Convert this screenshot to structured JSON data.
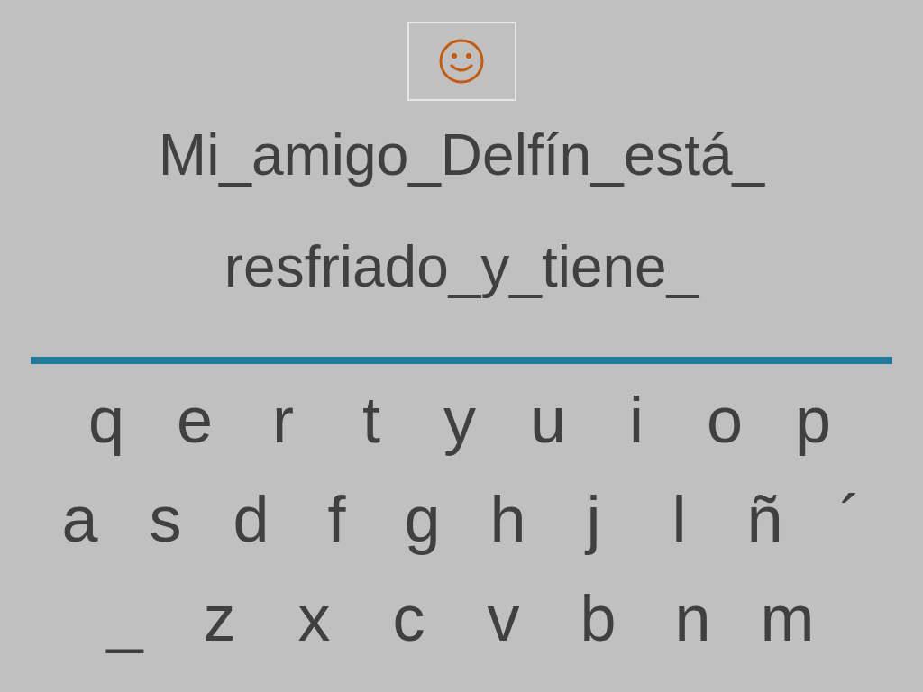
{
  "sentence_lines": [
    "Mi_amigo_Delfín_está_",
    "resfriado_y_tiene_"
  ],
  "keyboard": {
    "rows": [
      {
        "keys": [
          "q",
          "e",
          "r",
          "t",
          "y",
          "u",
          "i",
          "o",
          "p"
        ]
      },
      {
        "keys": [
          "a",
          "s",
          "d",
          "f",
          "g",
          "h",
          "j",
          "l",
          "ñ",
          "´"
        ]
      },
      {
        "keys": [
          "_",
          "z",
          "x",
          "c",
          "v",
          "b",
          "n",
          "m"
        ]
      }
    ]
  }
}
